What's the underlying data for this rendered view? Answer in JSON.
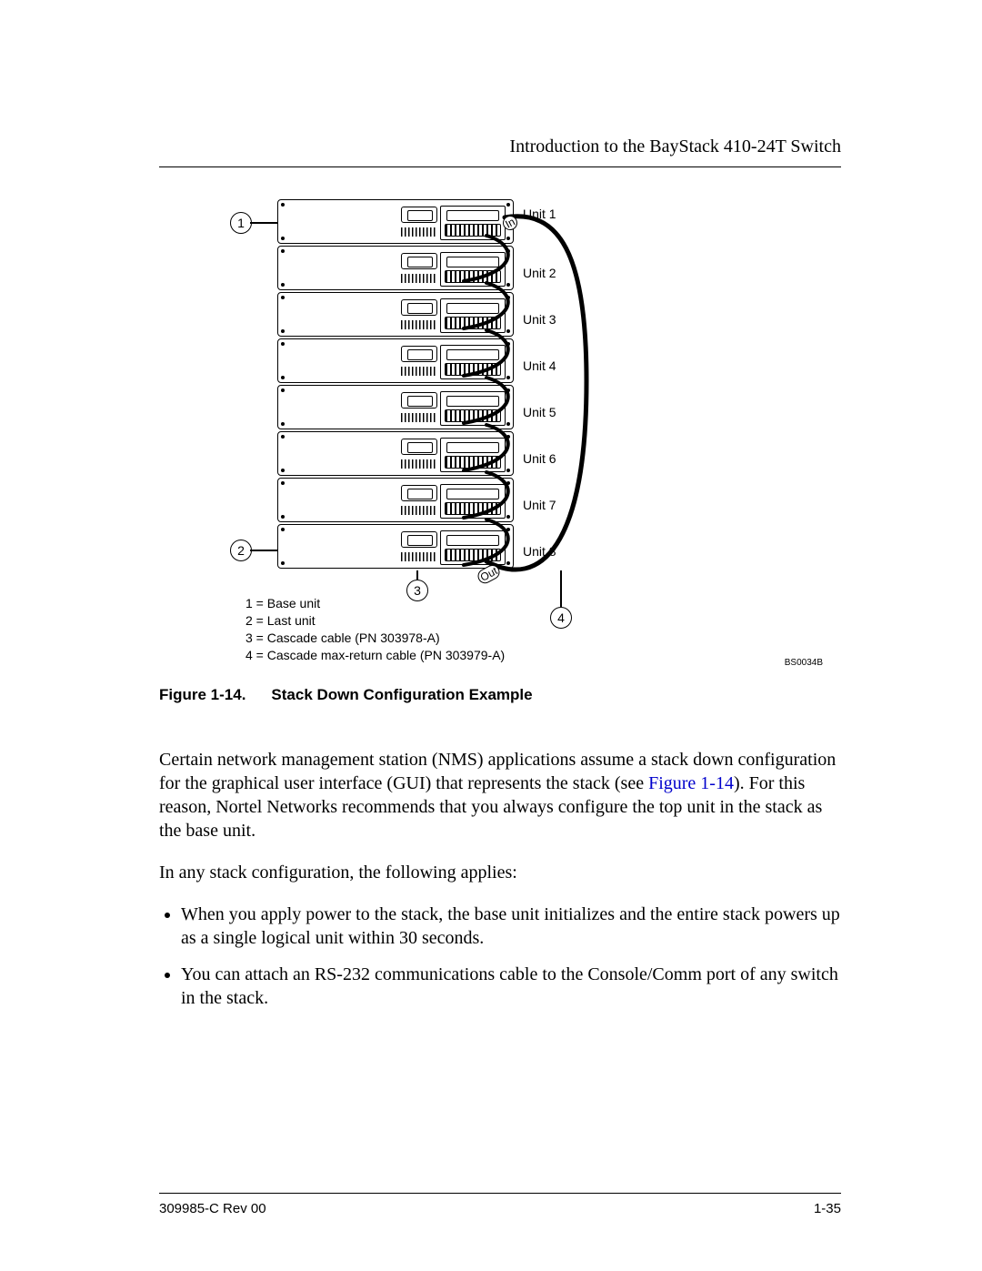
{
  "header": {
    "title": "Introduction to the BayStack 410-24T Switch"
  },
  "figure": {
    "units": [
      "Unit 1",
      "Unit 2",
      "Unit 3",
      "Unit 4",
      "Unit 5",
      "Unit 6",
      "Unit 7",
      "Unit 8"
    ],
    "callouts": {
      "c1": "1",
      "c2": "2",
      "c3": "3",
      "c4": "4"
    },
    "cable_labels": {
      "in": "In",
      "out": "Out"
    },
    "legend": {
      "l1": "1 = Base unit",
      "l2": "2 = Last unit",
      "l3": "3 = Cascade cable (PN 303978-A)",
      "l4": "4 = Cascade max-return cable (PN 303979-A)"
    },
    "code": "BS0034B",
    "caption_num": "Figure 1-14.",
    "caption_title": "Stack Down Configuration Example"
  },
  "body": {
    "p1a": "Certain network management station (NMS) applications assume a stack down configuration for the graphical user interface (GUI) that represents the stack (see ",
    "p1_link": "Figure 1-14",
    "p1b": "). For this reason, Nortel Networks recommends that you always configure the top unit in the stack as the base unit.",
    "p2": "In any stack configuration, the following applies:",
    "b1": "When you apply power to the stack, the base unit initializes and the entire stack powers up as a single logical unit within 30 seconds.",
    "b2": "You can attach an RS-232 communications cable to the Console/Comm port of any switch in the stack."
  },
  "footer": {
    "doc": "309985-C Rev 00",
    "page": "1-35"
  }
}
